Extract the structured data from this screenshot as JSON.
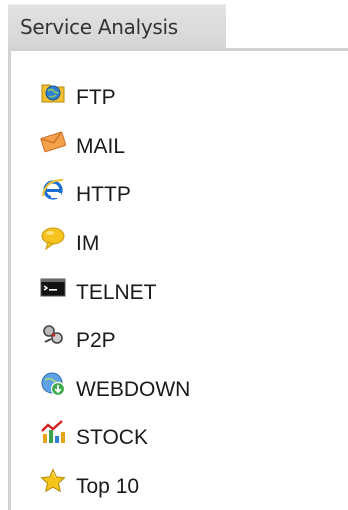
{
  "header": {
    "title": "Service Analysis"
  },
  "services": [
    {
      "label": "FTP",
      "icon": "ftp-icon"
    },
    {
      "label": "MAIL",
      "icon": "mail-icon"
    },
    {
      "label": "HTTP",
      "icon": "http-icon"
    },
    {
      "label": "IM",
      "icon": "im-icon"
    },
    {
      "label": "TELNET",
      "icon": "telnet-icon"
    },
    {
      "label": "P2P",
      "icon": "p2p-icon"
    },
    {
      "label": "WEBDOWN",
      "icon": "webdown-icon"
    },
    {
      "label": "STOCK",
      "icon": "stock-icon"
    },
    {
      "label": "Top 10",
      "icon": "star-icon"
    }
  ],
  "colors": {
    "header_bg": "#dcdcdc",
    "border": "#d2d2d2",
    "text": "#1a1a1a"
  }
}
